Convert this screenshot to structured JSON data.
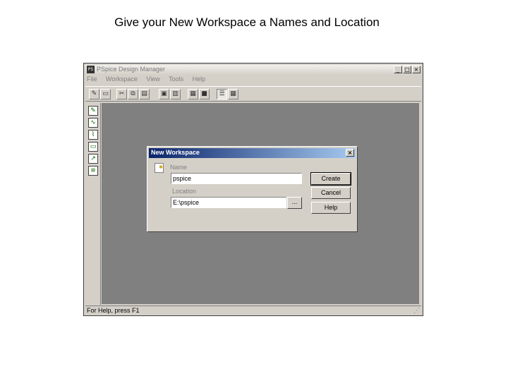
{
  "slide": {
    "title": "Give your New Workspace a Names and Location"
  },
  "app": {
    "title": "PSpice Design Manager",
    "icon_text": "PS",
    "window_controls": {
      "minimize": "_",
      "maximize": "□",
      "close": "×"
    },
    "menu": [
      "File",
      "Workspace",
      "View",
      "Tools",
      "Help"
    ],
    "status": "For Help, press F1",
    "toolbar_icons": [
      "new-icon",
      "open-icon",
      "cut-icon",
      "copy-icon",
      "paste-icon",
      "properties-icon",
      "rename-icon",
      "cut-files-icon",
      "paste-files-icon",
      "view-list-icon",
      "view-details-icon"
    ],
    "left_tools": [
      "schematics-tool-icon",
      "pspice-tool-icon",
      "probe-tool-icon",
      "stimulus-tool-icon",
      "parts-tool-icon",
      "optimizer-tool-icon"
    ]
  },
  "dialog": {
    "title": "New Workspace",
    "close": "×",
    "name_label": "Name",
    "name_value": "pspice",
    "location_label": "Location",
    "location_value": "E:\\pspice",
    "browse_label": "...",
    "create_label": "Create",
    "cancel_label": "Cancel",
    "help_label": "Help"
  }
}
